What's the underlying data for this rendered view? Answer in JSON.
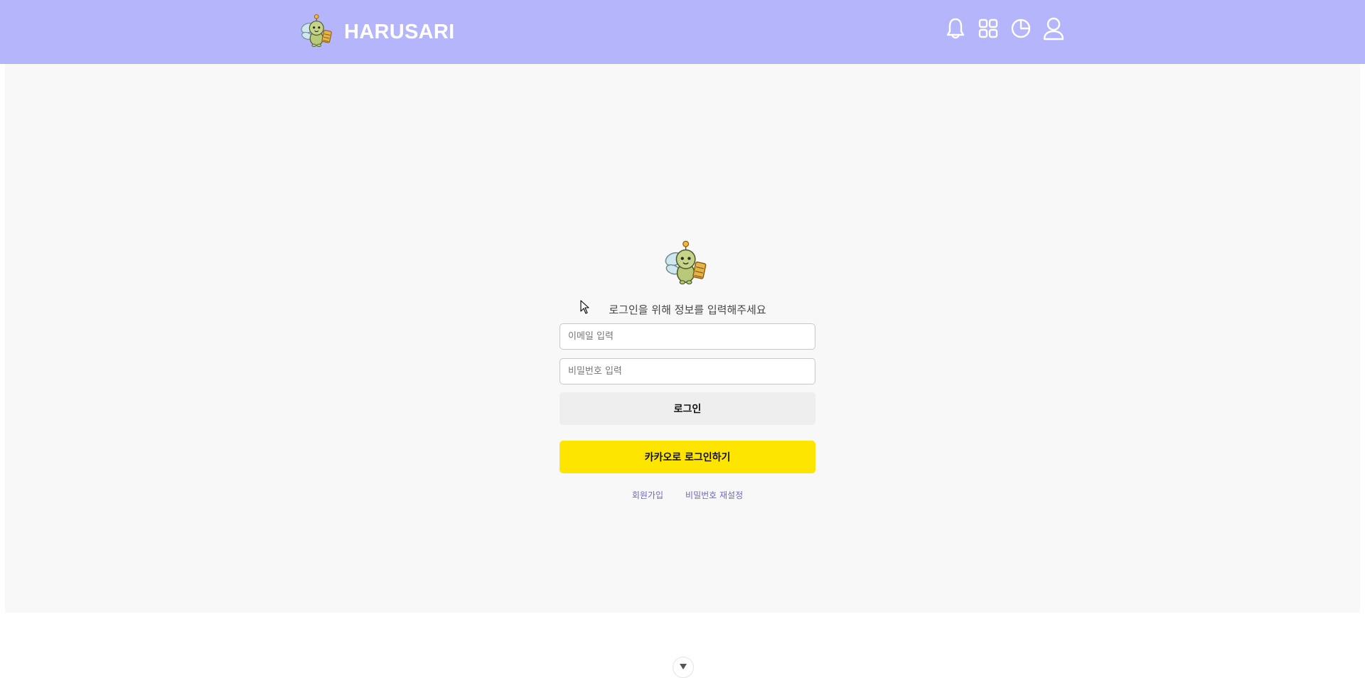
{
  "header": {
    "brand_name": "HARUSARI",
    "logo_icon": "bee-mascot-icon",
    "icons": [
      "bell-icon",
      "grid-icon",
      "pie-chart-icon",
      "user-icon"
    ],
    "background_color": "#b5b5fb"
  },
  "login": {
    "mascot_icon": "bee-mascot-icon",
    "prompt": "로그인을 위해 정보를 입력해주세요",
    "email_placeholder": "이메일 입력",
    "email_value": "",
    "password_placeholder": "비밀번호 입력",
    "password_value": "",
    "login_button": "로그인",
    "kakao_button": "카카오로 로그인하기",
    "kakao_color": "#fee500",
    "signup_link": "회원가입",
    "reset_password_link": "비밀번호 재설정"
  },
  "scroll": {
    "icon": "chevron-down-icon"
  }
}
